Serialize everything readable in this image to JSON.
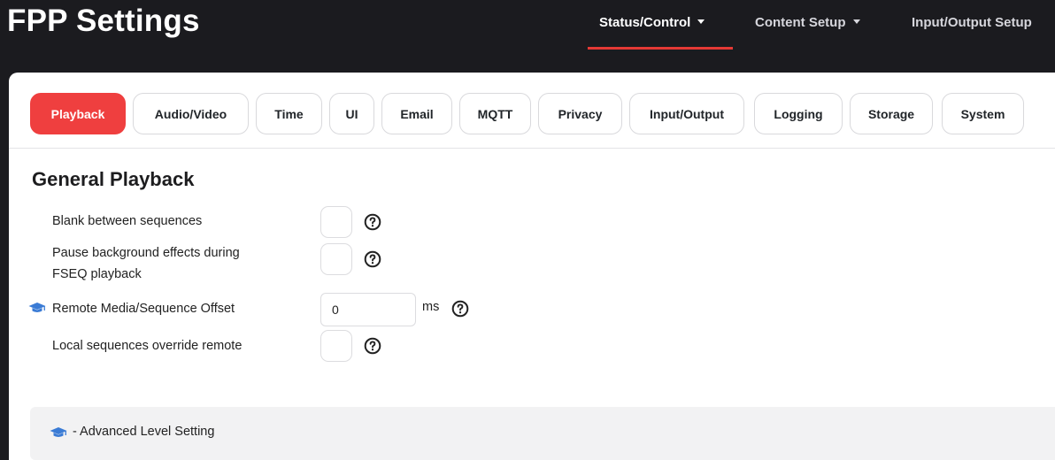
{
  "header": {
    "app_title": "FPP Settings",
    "nav": [
      {
        "label": "Status/Control",
        "active": true
      },
      {
        "label": "Content Setup",
        "active": false
      },
      {
        "label": "Input/Output Setup",
        "active": false
      }
    ],
    "accent_color": "#e53935"
  },
  "tabs": [
    {
      "label": "Playback",
      "active": true
    },
    {
      "label": "Audio/Video",
      "active": false
    },
    {
      "label": "Time",
      "active": false
    },
    {
      "label": "UI",
      "active": false
    },
    {
      "label": "Email",
      "active": false
    },
    {
      "label": "MQTT",
      "active": false
    },
    {
      "label": "Privacy",
      "active": false
    },
    {
      "label": "Input/Output",
      "active": false
    },
    {
      "label": "Logging",
      "active": false
    },
    {
      "label": "Storage",
      "active": false
    },
    {
      "label": "System",
      "active": false
    }
  ],
  "section": {
    "title": "General Playback",
    "settings": [
      {
        "label": "Blank between sequences",
        "type": "checkbox",
        "checked": false,
        "advanced": false
      },
      {
        "label_line1": "Pause background effects during",
        "label_line2": "FSEQ playback",
        "type": "checkbox",
        "checked": false,
        "advanced": false
      },
      {
        "label": "Remote Media/Sequence Offset",
        "type": "number",
        "value": "0",
        "unit": "ms",
        "advanced": true,
        "icon": "graduation-cap-icon"
      },
      {
        "label": "Local sequences override remote",
        "type": "checkbox",
        "checked": false,
        "advanced": false
      }
    ]
  },
  "footer": {
    "icon": "graduation-cap-icon",
    "text": "- Advanced Level Setting"
  },
  "colors": {
    "active_tab": "#ef3f3f",
    "advanced_icon": "#3a7bd5"
  }
}
